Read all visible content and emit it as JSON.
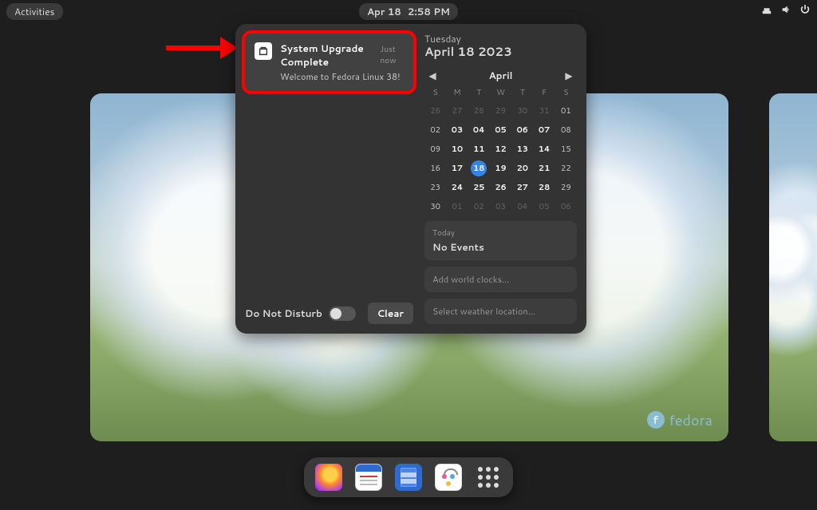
{
  "topbar": {
    "activities": "Activities",
    "date": "Apr 18",
    "time": "2:58 PM"
  },
  "notification": {
    "title": "System Upgrade Complete",
    "time": "Just now",
    "body": "Welcome to Fedora Linux 38!"
  },
  "dnd_label": "Do Not Disturb",
  "clear_label": "Clear",
  "date_panel": {
    "dow": "Tuesday",
    "full": "April 18 2023"
  },
  "calendar": {
    "month": "April",
    "headers": [
      "S",
      "M",
      "T",
      "W",
      "T",
      "F",
      "S"
    ],
    "rows": [
      [
        {
          "n": "26",
          "dim": true
        },
        {
          "n": "27",
          "dim": true
        },
        {
          "n": "28",
          "dim": true
        },
        {
          "n": "29",
          "dim": true
        },
        {
          "n": "30",
          "dim": true
        },
        {
          "n": "31",
          "dim": true
        },
        {
          "n": "01"
        }
      ],
      [
        {
          "n": "02"
        },
        {
          "n": "03",
          "bold": true
        },
        {
          "n": "04",
          "bold": true
        },
        {
          "n": "05",
          "bold": true
        },
        {
          "n": "06",
          "bold": true
        },
        {
          "n": "07",
          "bold": true
        },
        {
          "n": "08"
        }
      ],
      [
        {
          "n": "09"
        },
        {
          "n": "10",
          "bold": true
        },
        {
          "n": "11",
          "bold": true
        },
        {
          "n": "12",
          "bold": true
        },
        {
          "n": "13",
          "bold": true
        },
        {
          "n": "14",
          "bold": true
        },
        {
          "n": "15"
        }
      ],
      [
        {
          "n": "16"
        },
        {
          "n": "17",
          "bold": true
        },
        {
          "n": "18",
          "today": true
        },
        {
          "n": "19",
          "bold": true
        },
        {
          "n": "20",
          "bold": true
        },
        {
          "n": "21",
          "bold": true
        },
        {
          "n": "22"
        }
      ],
      [
        {
          "n": "23"
        },
        {
          "n": "24",
          "bold": true
        },
        {
          "n": "25",
          "bold": true
        },
        {
          "n": "26",
          "bold": true
        },
        {
          "n": "27",
          "bold": true
        },
        {
          "n": "28",
          "bold": true
        },
        {
          "n": "29"
        }
      ],
      [
        {
          "n": "30"
        },
        {
          "n": "01",
          "dim": true
        },
        {
          "n": "02",
          "dim": true
        },
        {
          "n": "03",
          "dim": true
        },
        {
          "n": "04",
          "dim": true
        },
        {
          "n": "05",
          "dim": true
        },
        {
          "n": "06",
          "dim": true
        }
      ]
    ]
  },
  "events": {
    "label": "Today",
    "value": "No Events"
  },
  "clocks_placeholder": "Add world clocks…",
  "weather_placeholder": "Select weather location…",
  "fedora_brand": "fedora",
  "dock": {
    "apps": [
      "firefox",
      "calendar",
      "files",
      "software",
      "apps-grid"
    ]
  }
}
